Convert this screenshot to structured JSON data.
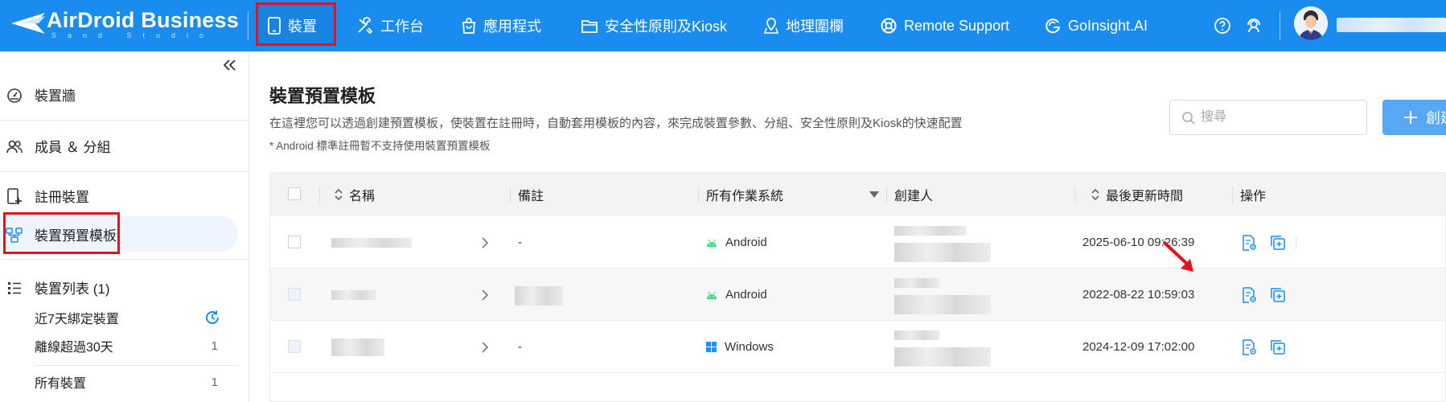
{
  "brand": {
    "name": "AirDroid Business",
    "tagline": "Sand Studio"
  },
  "nav": {
    "items": [
      {
        "label": "裝置",
        "icon": "tablet-icon"
      },
      {
        "label": "工作台",
        "icon": "tools-icon"
      },
      {
        "label": "應用程式",
        "icon": "shopping-bag-icon"
      },
      {
        "label": "安全性原則及Kiosk",
        "icon": "folder-icon"
      },
      {
        "label": "地理圍欄",
        "icon": "map-pin-icon"
      },
      {
        "label": "Remote Support",
        "icon": "lifebuoy-icon"
      },
      {
        "label": "GoInsight.AI",
        "icon": "goinsight-icon"
      }
    ],
    "active": "裝置"
  },
  "sidebar": {
    "items": [
      {
        "label": "裝置牆",
        "icon": "dashboard-icon"
      },
      {
        "label": "成員 ＆ 分組",
        "icon": "users-icon"
      },
      {
        "label": "註冊裝置",
        "icon": "register-device-icon"
      },
      {
        "label": "裝置預置模板",
        "icon": "template-icon"
      },
      {
        "label": "裝置列表 (1)",
        "icon": "list-icon"
      }
    ],
    "sub_items": [
      {
        "label": "近7天綁定裝置",
        "count": ""
      },
      {
        "label": "離線超過30天",
        "count": "1"
      },
      {
        "label": "所有裝置",
        "count": "1"
      }
    ]
  },
  "page": {
    "title": "裝置預置模板",
    "description": "在這裡您可以透過創建預置模板，使裝置在註冊時，自動套用模板的內容，來完成裝置參數、分組、安全性原則及Kiosk的快速配置",
    "note": "* Android 標準註冊暫不支持使用裝置預置模板",
    "search_placeholder": "搜尋",
    "create_label": "創建"
  },
  "table": {
    "columns": {
      "name": "名稱",
      "remark": "備註",
      "os": "所有作業系統",
      "creator": "創建人",
      "updated": "最後更新時間",
      "actions": "操作"
    },
    "rows": [
      {
        "remark": "-",
        "os": "Android",
        "os_icon": "android-icon",
        "updated": "2025-06-10 09:26:39"
      },
      {
        "remark": "",
        "os": "Android",
        "os_icon": "android-icon",
        "updated": "2022-08-22 10:59:03"
      },
      {
        "remark": "-",
        "os": "Windows",
        "os_icon": "windows-icon",
        "updated": "2024-12-09 17:02:00"
      }
    ]
  },
  "colors": {
    "topbar": "#1a8cf0",
    "accent": "#1a8cf0",
    "highlight_red": "#e8101a",
    "android_green": "#3ddc84",
    "windows_blue": "#1e90ff"
  }
}
